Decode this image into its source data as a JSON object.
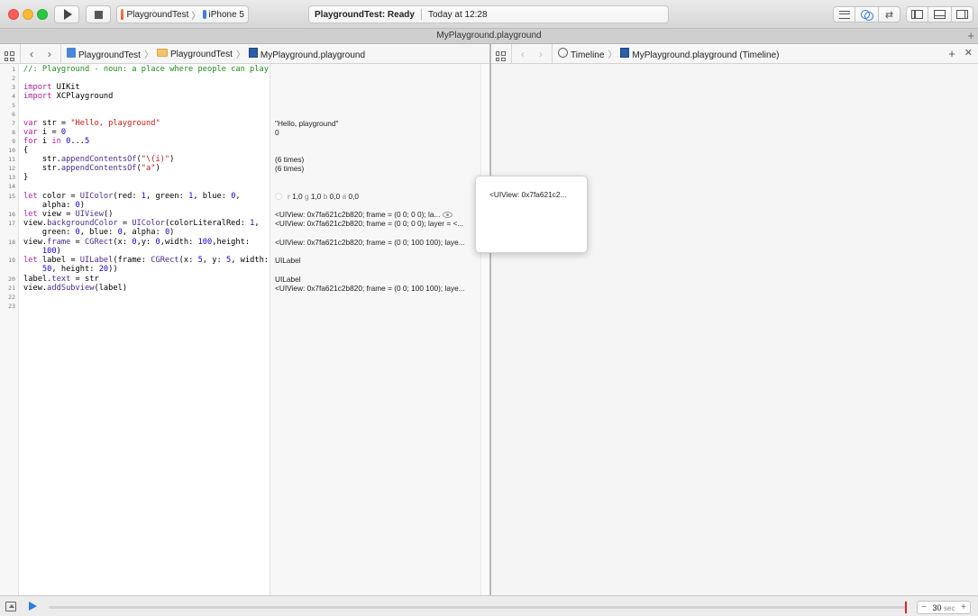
{
  "toolbar": {
    "scheme_name": "PlaygroundTest",
    "device_name": "iPhone 5",
    "status_bold": "PlaygroundTest: Ready",
    "status_time": "Today at 12:28"
  },
  "tab": {
    "title": "MyPlayground.playground",
    "add_label": "+"
  },
  "left_jumpbar": {
    "crumbs": [
      "PlaygroundTest",
      "PlaygroundTest",
      "MyPlayground.playground"
    ]
  },
  "right_jumpbar": {
    "crumbs": [
      "Timeline",
      "MyPlayground.playground (Timeline)"
    ],
    "add_label": "+",
    "close_label": "✕"
  },
  "code": {
    "line_numbers": [
      "1",
      "2",
      "3",
      "4",
      "5",
      "6",
      "7",
      "8",
      "9",
      "10",
      "11",
      "12",
      "13",
      "14",
      "15",
      "16",
      "17",
      "18",
      "19",
      "20",
      "21",
      "22",
      "23"
    ],
    "lines": [
      "//: Playground - noun: a place where people can play",
      "import UIKit",
      "import XCPlayground",
      "var str = \"Hello, playground\"",
      "var i = 0",
      "for i in 0...5",
      "{",
      "    str.appendContentsOf(\"\\(i)\")",
      "    str.appendContentsOf(\"a\")",
      "}",
      "let color = UIColor(red: 1, green: 1, blue: 0,",
      "    alpha: 0)",
      "let view = UIView()",
      "view.backgroundColor = UIColor(colorLiteralRed: 1,",
      "    green: 0, blue: 0, alpha: 0)",
      "view.frame = CGRect(x: 0,y: 0,width: 100,height:",
      "    100)",
      "let label = UILabel(frame: CGRect(x: 5, y: 5, width:",
      "    50, height: 20))",
      "label.text = str",
      "view.addSubview(label)"
    ]
  },
  "results": {
    "r7": "\"Hello, playground\"",
    "r8": "0",
    "r11": "(6 times)",
    "r12": "(6 times)",
    "r15_r": "r",
    "r15_rv": "1,0",
    "r15_g": "g",
    "r15_gv": "1,0",
    "r15_b": "b",
    "r15_bv": "0,0",
    "r15_a": "a",
    "r15_av": "0,0",
    "r16": "<UIView: 0x7fa621c2b820; frame = (0 0; 0 0); la...",
    "r17": "<UIView: 0x7fa621c2b820; frame = (0 0; 0 0); layer = <...",
    "r18": "<UIView: 0x7fa621c2b820; frame = (0 0; 100 100); laye...",
    "r19": "UILabel",
    "r20": "UILabel",
    "r21": "<UIView: 0x7fa621c2b820; frame = (0 0; 100 100); laye..."
  },
  "popover": {
    "text": "<UIView: 0x7fa621c2..."
  },
  "bottom": {
    "playhead": 0.999,
    "duration_value": "30",
    "duration_unit": "sec",
    "minus": "−",
    "plus": "+"
  },
  "colors": {
    "accent": "#2d7be0",
    "playhead": "#e0241c",
    "comment": "#1f8b1f"
  },
  "icons": [
    "play-icon",
    "stop-icon",
    "swift-icon",
    "device-icon",
    "grid-icon",
    "back-chevron-icon",
    "forward-chevron-icon",
    "folder-icon",
    "playground-file-icon",
    "clock-icon",
    "eye-icon"
  ]
}
